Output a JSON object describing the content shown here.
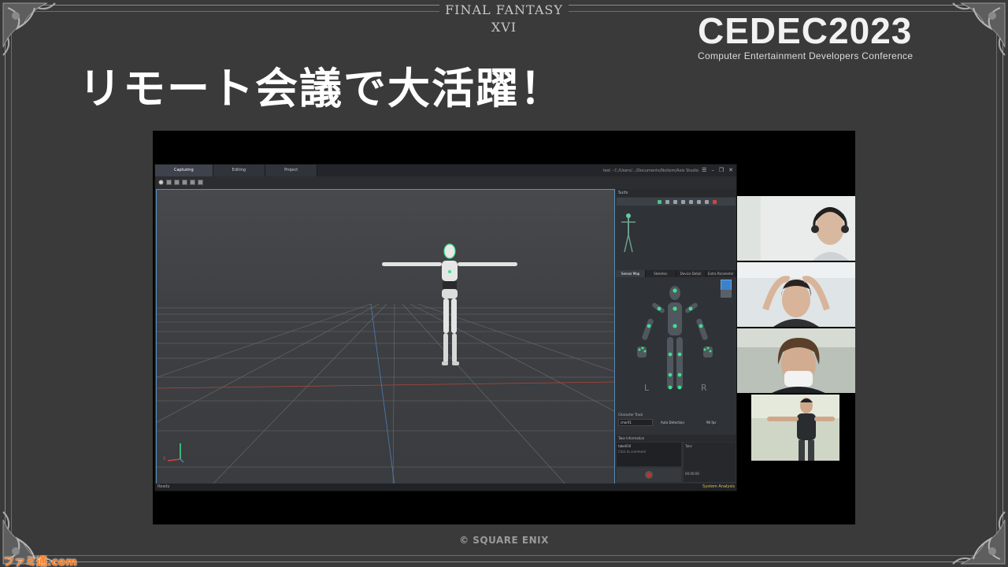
{
  "slide": {
    "game_title": "FINAL FANTASY XVI",
    "conference_logo": "CEDEC2023",
    "conference_subtitle": "Computer Entertainment Developers Conference",
    "headline": "リモート会議で大活躍！",
    "copyright": "© SQUARE ENIX",
    "watermark": "ファミ通.com"
  },
  "app": {
    "tabs": [
      {
        "label": "Capturing",
        "active": true
      },
      {
        "label": "Editing",
        "active": false
      },
      {
        "label": "Project",
        "active": false
      }
    ],
    "file_path": "test - C:/Users/.../Documents/Noitom/Axis Studio",
    "window_buttons": {
      "menu": "☰",
      "minimize": "–",
      "maximize": "❐",
      "close": "✕"
    },
    "status_left": "Ready",
    "status_right": "System Analysis",
    "viewport_axis_label": "Z",
    "panel": {
      "header": "Suits",
      "tabs": [
        {
          "label": "Sensor Map",
          "active": true
        },
        {
          "label": "Skeleton",
          "active": false
        },
        {
          "label": "Device Detail",
          "active": false
        },
        {
          "label": "Extra Parameter",
          "active": false
        }
      ],
      "left_label": "L",
      "right_label": "R",
      "character_header": "Character Track",
      "character_value": "char01",
      "auto_detection": "Auto Detection",
      "rate": "96 fps",
      "take_header": "Take Information",
      "take_name": "take010",
      "take_comment": "Click to comment",
      "take_right": "Take",
      "take_time": "00:00:00"
    }
  },
  "colors": {
    "slide_bg": "#3a3a3a",
    "viewport_border": "#5a8ec0",
    "sensor_green": "#3ee08a",
    "record_red": "#c0322a",
    "watermark_orange": "#ff7a1a"
  }
}
